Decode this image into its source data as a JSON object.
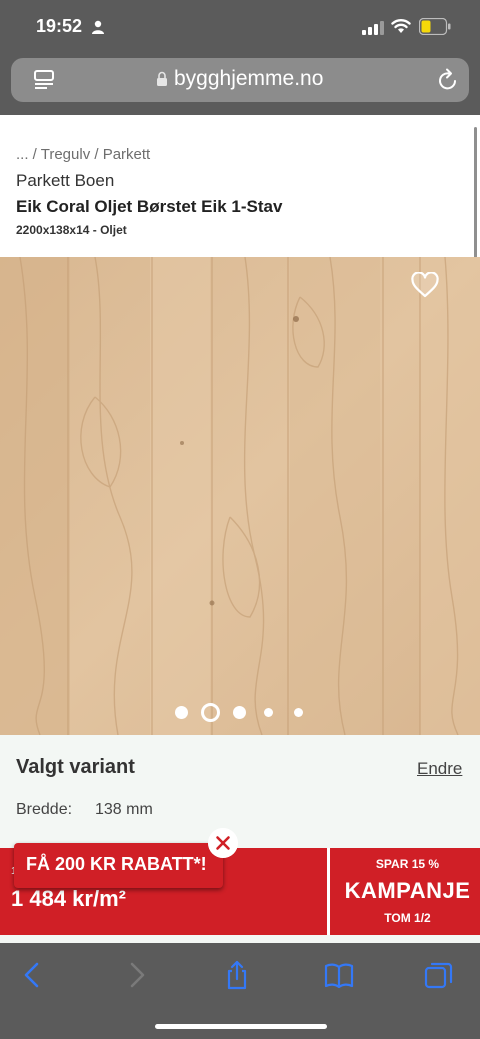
{
  "status_bar": {
    "time": "19:52"
  },
  "browser": {
    "url": "bygghjemme.no"
  },
  "product": {
    "breadcrumb": "... / Tregulv / Parkett",
    "brand": "Parkett Boen",
    "title": "Eik Coral Oljet Børstet Eik 1-Stav",
    "subtitle": "2200x138x14 - Oljet",
    "image_dots": {
      "count": 5,
      "active_index": 1
    }
  },
  "variant": {
    "heading": "Valgt variant",
    "change_label": "Endre",
    "width_label": "Bredde:",
    "width_value": "138 mm"
  },
  "price_bar": {
    "partial_label": "1",
    "price": "1 484 kr/m²",
    "campaign_top": "SPAR 15 %",
    "campaign_main": "KAMPANJE",
    "campaign_date": "TOM 1/2"
  },
  "promo": {
    "discount_label": "FÅ 200 KR RABATT*!"
  },
  "colors": {
    "brand_red": "#d01f26",
    "ios_blue": "#3478f6",
    "chrome_gray": "#5b5b5b"
  }
}
